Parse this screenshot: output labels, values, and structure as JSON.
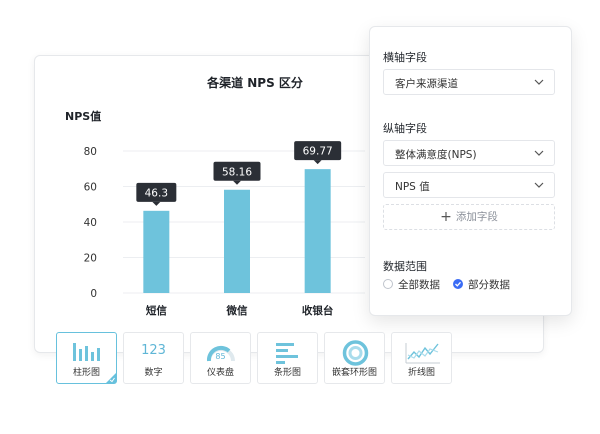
{
  "chart": {
    "title": "各渠道 NPS 区分",
    "ylabel": "NPS值"
  },
  "chart_data": {
    "type": "bar",
    "title": "各渠道 NPS 区分",
    "ylabel": "NPS值",
    "xlabel": "",
    "categories": [
      "短信",
      "微信",
      "收银台"
    ],
    "values": [
      46.3,
      58.16,
      69.77
    ],
    "data_labels": [
      "46.3",
      "58.16",
      "69.77"
    ],
    "ylim": [
      0,
      80
    ],
    "yticks": [
      0,
      20,
      40,
      60,
      80
    ],
    "bar_color": "#6ec3dc",
    "grid": true,
    "legend": "none"
  },
  "panel": {
    "x_axis_label": "横轴字段",
    "x_axis_value": "客户来源渠道",
    "y_axis_label": "纵轴字段",
    "y_axis_values": [
      "整体满意度(NPS)",
      "NPS 值"
    ],
    "add_field": "添加字段",
    "range_label": "数据范围",
    "range_options": [
      {
        "label": "全部数据",
        "selected": false
      },
      {
        "label": "部分数据",
        "selected": true
      }
    ],
    "accent": "#3b6cf5"
  },
  "chart_types": [
    {
      "name": "bar",
      "label": "柱形图",
      "active": true
    },
    {
      "name": "number",
      "label": "数字",
      "icon_text": "123"
    },
    {
      "name": "gauge",
      "label": "仪表盘",
      "icon_text": "85"
    },
    {
      "name": "hbar",
      "label": "条形图"
    },
    {
      "name": "donut",
      "label": "嵌套环形图"
    },
    {
      "name": "line",
      "label": "折线图"
    }
  ]
}
